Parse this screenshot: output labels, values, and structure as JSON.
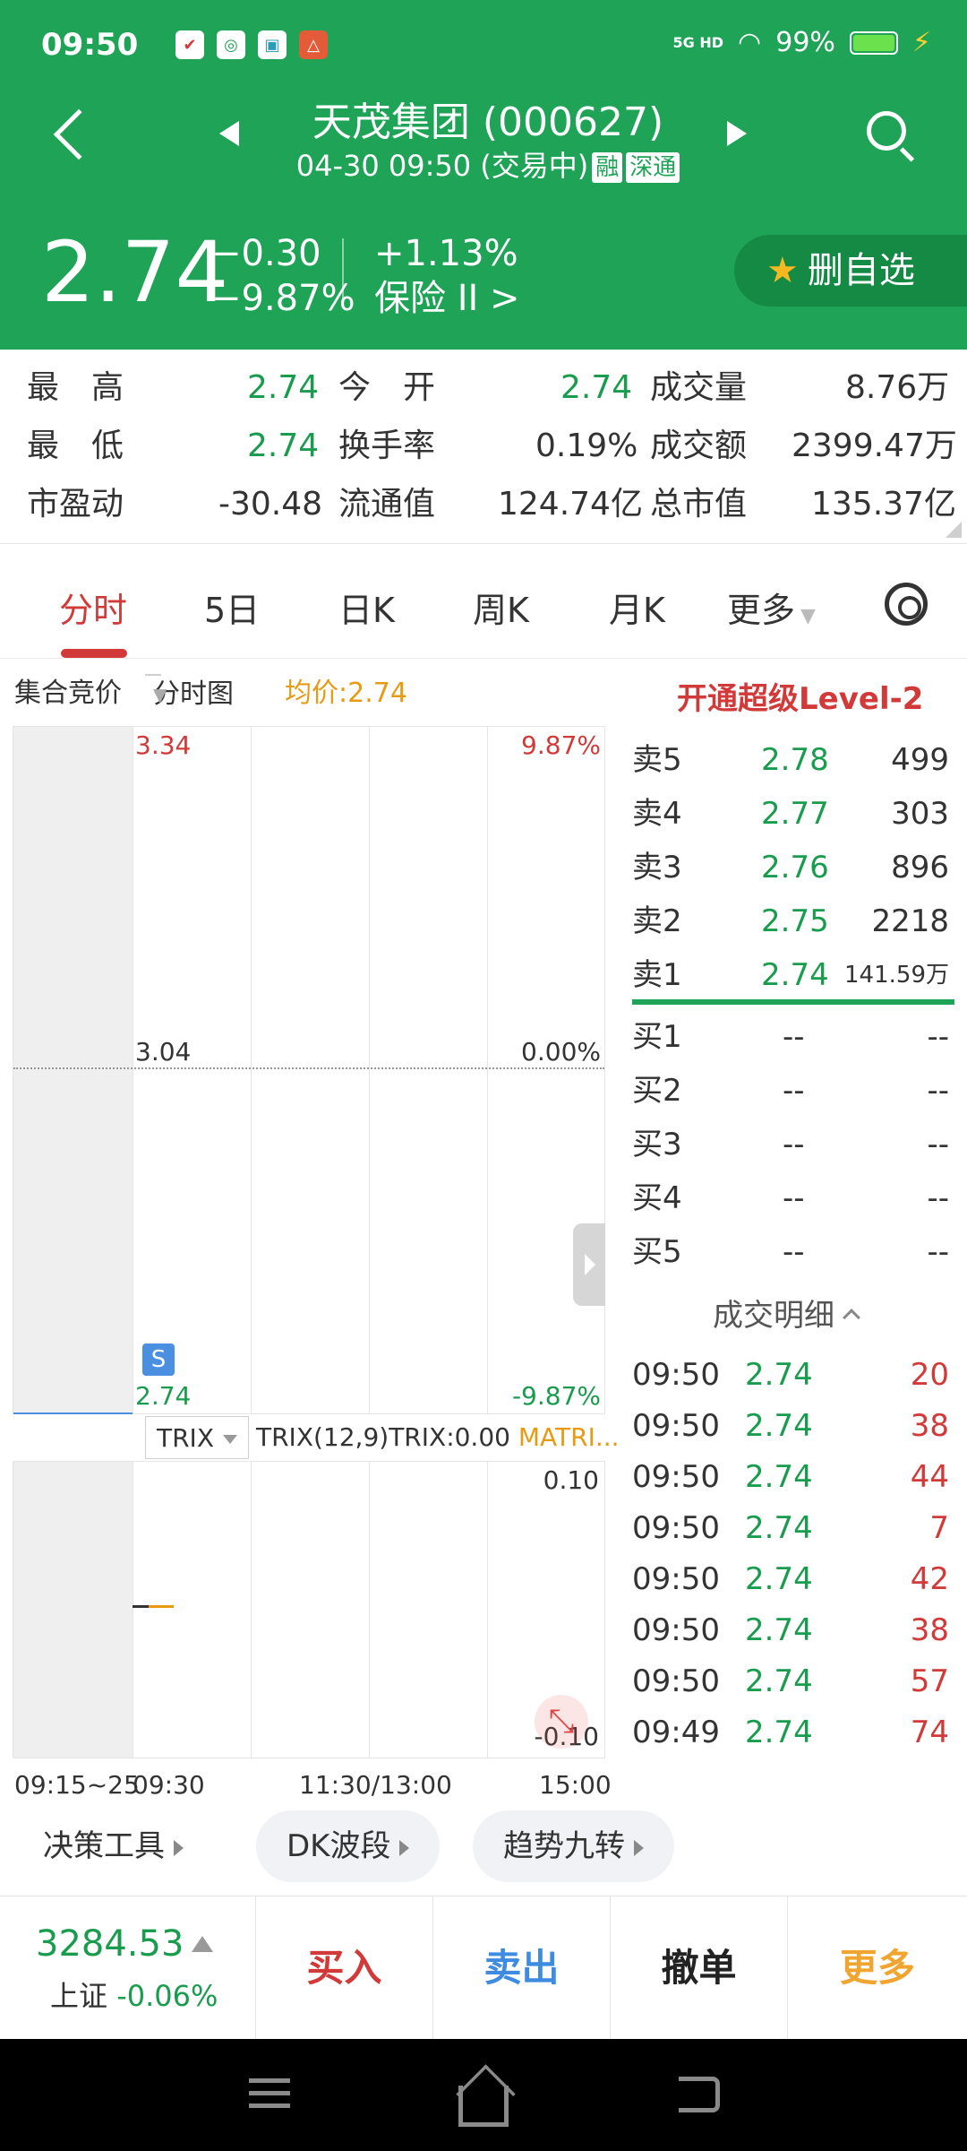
{
  "status": {
    "time": "09:50",
    "network": "5G HD",
    "battery": "99%"
  },
  "header": {
    "title": "天茂集团 (000627)",
    "subtitle": "04-30 09:50 (交易中)",
    "tag1": "融",
    "tag2": "深通",
    "price": "2.74",
    "change": "−0.30",
    "change_pct": "−9.87%",
    "sector_pct": "+1.13%",
    "sector": "保险 II  >",
    "fav_label": "删自选"
  },
  "stats": {
    "high_label": "最　高",
    "high": "2.74",
    "open_label": "今　开",
    "open": "2.74",
    "vol_label": "成交量",
    "vol": "8.76万",
    "low_label": "最　低",
    "low": "2.74",
    "turnover_label": "换手率",
    "turnover": "0.19%",
    "amount_label": "成交额",
    "amount": "2399.47万",
    "pe_label": "市盈动",
    "pe": "-30.48",
    "float_label": "流通值",
    "float": "124.74亿",
    "mcap_label": "总市值",
    "mcap": "135.37亿"
  },
  "tabs": [
    "分时",
    "5日",
    "日K",
    "周K",
    "月K",
    "更多"
  ],
  "chart": {
    "auction_label": "集合竞价",
    "mode": "分时图",
    "avg": "均价:2.74",
    "top_price": "3.34",
    "top_pct": "9.87%",
    "mid_price": "3.04",
    "mid_pct": "0.00%",
    "bot_price": "2.74",
    "bot_pct": "-9.87%",
    "s_badge": "S",
    "indicator": "TRIX",
    "indicator_text": "TRIX(12,9)TRIX:0.00",
    "indicator_extra": "MATRI...",
    "sub_top": "0.10",
    "sub_bot": "-0.10",
    "times": [
      "09:15~25",
      "09:30",
      "11:30/13:00",
      "15:00"
    ]
  },
  "orderbook": {
    "level2": "开通超级Level-2",
    "asks": [
      {
        "label": "卖5",
        "price": "2.78",
        "vol": "499"
      },
      {
        "label": "卖4",
        "price": "2.77",
        "vol": "303"
      },
      {
        "label": "卖3",
        "price": "2.76",
        "vol": "896"
      },
      {
        "label": "卖2",
        "price": "2.75",
        "vol": "2218"
      },
      {
        "label": "卖1",
        "price": "2.74",
        "vol": "141.59万"
      }
    ],
    "bids": [
      {
        "label": "买1",
        "price": "--",
        "vol": "--"
      },
      {
        "label": "买2",
        "price": "--",
        "vol": "--"
      },
      {
        "label": "买3",
        "price": "--",
        "vol": "--"
      },
      {
        "label": "买4",
        "price": "--",
        "vol": "--"
      },
      {
        "label": "买5",
        "price": "--",
        "vol": "--"
      }
    ],
    "detail_label": "成交明细",
    "trades": [
      {
        "time": "09:50",
        "price": "2.74",
        "vol": "20"
      },
      {
        "time": "09:50",
        "price": "2.74",
        "vol": "38"
      },
      {
        "time": "09:50",
        "price": "2.74",
        "vol": "44"
      },
      {
        "time": "09:50",
        "price": "2.74",
        "vol": "7"
      },
      {
        "time": "09:50",
        "price": "2.74",
        "vol": "42"
      },
      {
        "time": "09:50",
        "price": "2.74",
        "vol": "38"
      },
      {
        "time": "09:50",
        "price": "2.74",
        "vol": "57"
      },
      {
        "time": "09:49",
        "price": "2.74",
        "vol": "74"
      }
    ]
  },
  "tools": [
    "决策工具",
    "DK波段",
    "趋势九转"
  ],
  "bottom": {
    "index_value": "3284.53",
    "index_name": "上证",
    "index_pct": "-0.06%",
    "buy": "买入",
    "sell": "卖出",
    "cancel": "撤单",
    "more": "更多"
  },
  "colors": {
    "brand_green": "#1fa356",
    "up_red": "#d23a3a",
    "down_green": "#1a9c4e",
    "accent_orange": "#e89a13"
  }
}
